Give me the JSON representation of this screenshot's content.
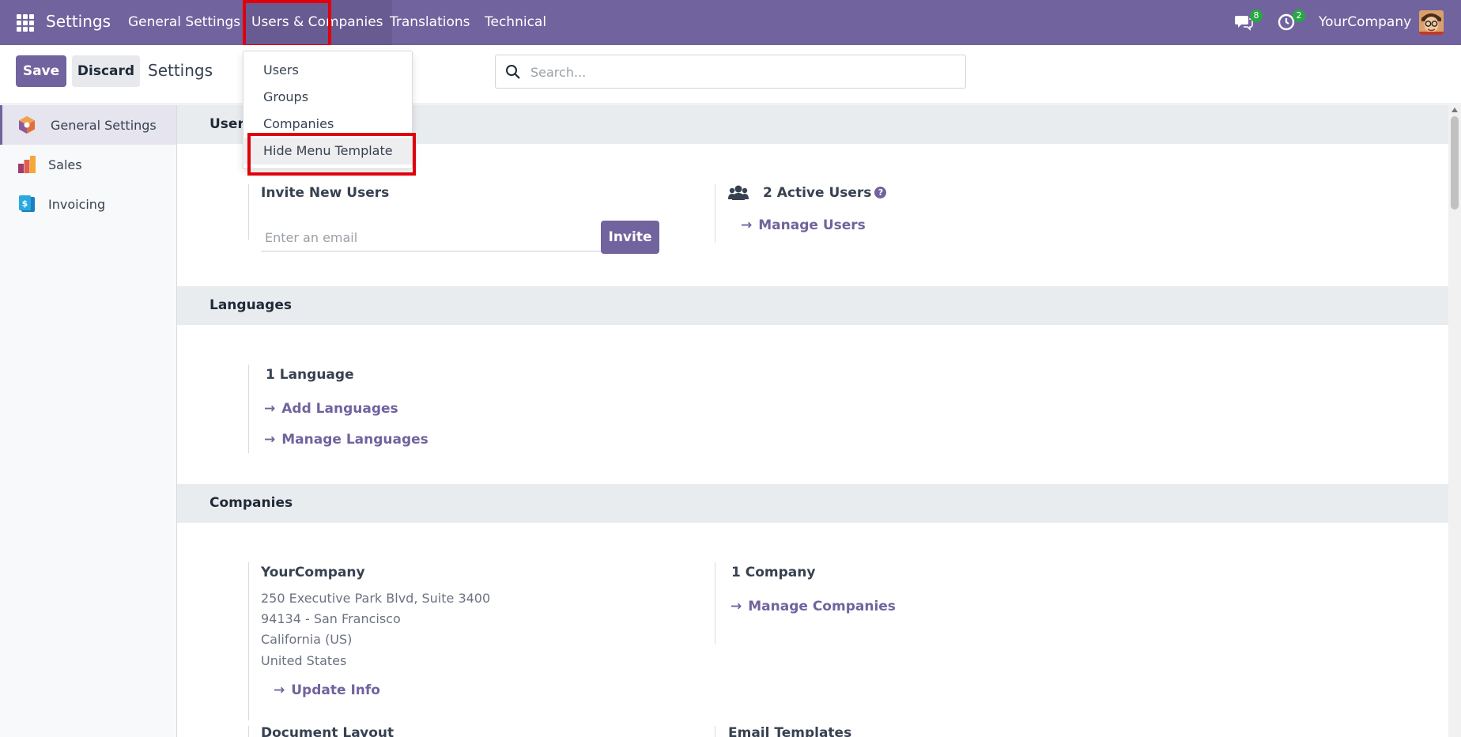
{
  "navbar": {
    "brand": "Settings",
    "menu": [
      "General Settings",
      "Users & Companies",
      "Translations",
      "Technical"
    ],
    "messages_badge": "8",
    "activities_badge": "2",
    "company": "YourCompany"
  },
  "dropdown": {
    "items": [
      "Users",
      "Groups",
      "Companies",
      "Hide Menu Template"
    ]
  },
  "control": {
    "save_label": "Save",
    "discard_label": "Discard",
    "title": "Settings",
    "search_placeholder": "Search..."
  },
  "sidebar": {
    "items": [
      "General Settings",
      "Sales",
      "Invoicing"
    ]
  },
  "users_section": {
    "title": "Users",
    "invite_label": "Invite New Users",
    "email_placeholder": "Enter an email",
    "invite_button": "Invite",
    "active_users": "2 Active Users",
    "manage_users": "Manage Users"
  },
  "languages_section": {
    "title": "Languages",
    "count": "1 Language",
    "add_languages": "Add Languages",
    "manage_languages": "Manage Languages"
  },
  "companies_section": {
    "title": "Companies",
    "company_name": "YourCompany",
    "address": [
      "250 Executive Park Blvd, Suite 3400",
      "94134 - San Francisco",
      "California (US)",
      "United States"
    ],
    "update_info": "Update Info",
    "company_count": "1 Company",
    "manage_companies": "Manage Companies",
    "document_layout": "Document Layout",
    "email_templates": "Email Templates"
  },
  "colors": {
    "brand": "#71639e",
    "highlight": "#e0000b",
    "badge": "#28a745"
  }
}
